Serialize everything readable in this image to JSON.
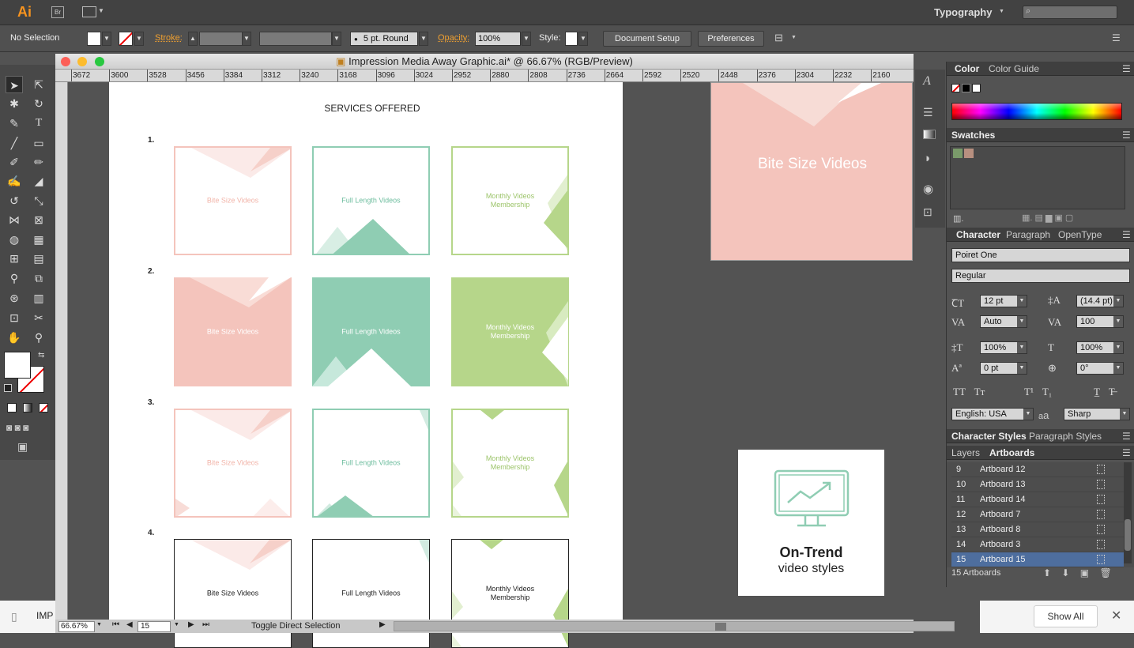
{
  "app": {
    "logo": "Ai",
    "bridge": "Br",
    "workspace": "Typography",
    "search_placeholder": ""
  },
  "control": {
    "selection": "No Selection",
    "stroke_label": "Stroke:",
    "brush": "5 pt. Round",
    "opacity_label": "Opacity:",
    "opacity": "100%",
    "style_label": "Style:",
    "document_setup": "Document Setup",
    "preferences": "Preferences"
  },
  "document": {
    "title": "Impression Media Away Graphic.ai* @ 66.67% (RGB/Preview)"
  },
  "ruler": [
    "3672",
    "3600",
    "3528",
    "3456",
    "3384",
    "3312",
    "3240",
    "3168",
    "3096",
    "3024",
    "2952",
    "2880",
    "2808",
    "2736",
    "2664",
    "2592",
    "2520",
    "2448",
    "2376",
    "2304",
    "2232",
    "2160"
  ],
  "artboard": {
    "heading": "SERVICES OFFERED",
    "rows": [
      {
        "num": "1.",
        "items": [
          "Bite Size Videos",
          "Full Length Videos",
          "Monthly Videos\nMembership"
        ]
      },
      {
        "num": "2.",
        "items": [
          "Bite Size Videos",
          "Full Length Videos",
          "Monthly Videos\nMembership"
        ]
      },
      {
        "num": "3.",
        "items": [
          "Bite Size Videos",
          "Full Length Videos",
          "Monthly Videos\nMembership"
        ]
      },
      {
        "num": "4.",
        "items": [
          "Bite Size Videos",
          "Full Length Videos",
          "Monthly Videos\nMembership"
        ]
      }
    ]
  },
  "preview": {
    "bite": "Bite Size Videos",
    "trend_title": "On-Trend",
    "trend_sub": "video styles"
  },
  "colors": {
    "pink": "#f4c4bc",
    "pink_dark": "#f2b5aa",
    "teal": "#8fcdb3",
    "green": "#b6d68a",
    "ai_orange": "#f7931e"
  },
  "panels": {
    "color_tab": "Color",
    "color_guide_tab": "Color Guide",
    "swatches": "Swatches",
    "character_tab": "Character",
    "paragraph_tab": "Paragraph",
    "opentype_tab": "OpenType",
    "font": "Poiret One",
    "style": "Regular",
    "size": "12 pt",
    "leading": "(14.4 pt)",
    "kerning": "Auto",
    "tracking": "100",
    "vscale": "100%",
    "hscale": "100%",
    "baseline": "0 pt",
    "rotation": "0°",
    "language": "English: USA",
    "aa_label": "a",
    "antialias": "Sharp",
    "char_styles": "Character Styles",
    "para_styles": "Paragraph Styles",
    "layers_tab": "Layers",
    "artboards_tab": "Artboards",
    "artboard_rows": [
      {
        "n": "9",
        "label": "Artboard 12"
      },
      {
        "n": "10",
        "label": "Artboard 13"
      },
      {
        "n": "11",
        "label": "Artboard 14"
      },
      {
        "n": "12",
        "label": "Artboard 7"
      },
      {
        "n": "13",
        "label": "Artboard 8"
      },
      {
        "n": "14",
        "label": "Artboard 3"
      },
      {
        "n": "15",
        "label": "Artboard 15"
      }
    ],
    "artboard_count": "15 Artboards"
  },
  "status": {
    "zoom": "66.67%",
    "artboard_num": "15",
    "tool_hint": "Toggle Direct Selection"
  },
  "os": {
    "file": "IMP",
    "show_all": "Show All"
  }
}
